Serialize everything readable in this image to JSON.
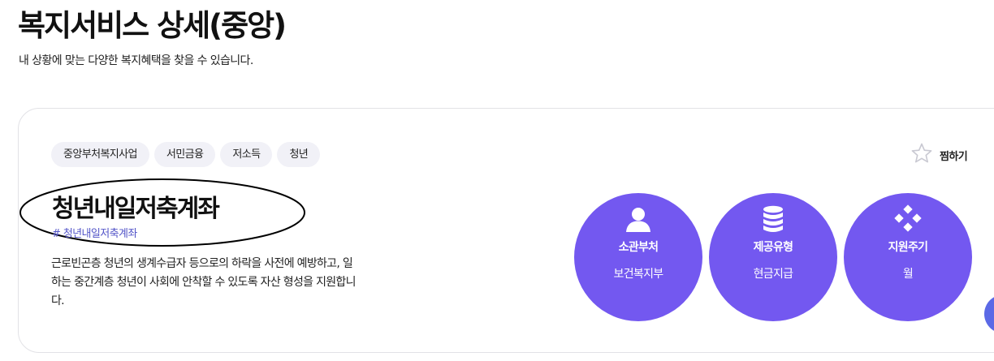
{
  "header": {
    "title": "복지서비스 상세(중앙)",
    "subtitle": "내 상황에 맞는 다양한 복지혜택을 찾을 수 있습니다."
  },
  "tags": [
    "중앙부처복지사업",
    "서민금융",
    "저소득",
    "청년"
  ],
  "bookmark": {
    "label": "찜하기",
    "icon": "star-outline-icon"
  },
  "service": {
    "title": "청년내일저축계좌",
    "hashtag": "# 청년내일저축계좌",
    "description": "근로빈곤층 청년의 생계수급자 등으로의 하락을 사전에 예방하고, 일하는 중간계층 청년이 사회에 안착할 수 있도록 자산 형성을 지원합니다."
  },
  "info": [
    {
      "label": "소관부처",
      "value": "보건복지부",
      "icon": "person-icon"
    },
    {
      "label": "제공유형",
      "value": "현금지급",
      "icon": "coin-stack-icon"
    },
    {
      "label": "지원주기",
      "value": "월",
      "icon": "diamond-dots-icon"
    }
  ],
  "colors": {
    "accent": "#7358f0",
    "hashtag": "#5355c8",
    "tag_bg": "#f1f1f7",
    "fab": "#5b69e6"
  }
}
